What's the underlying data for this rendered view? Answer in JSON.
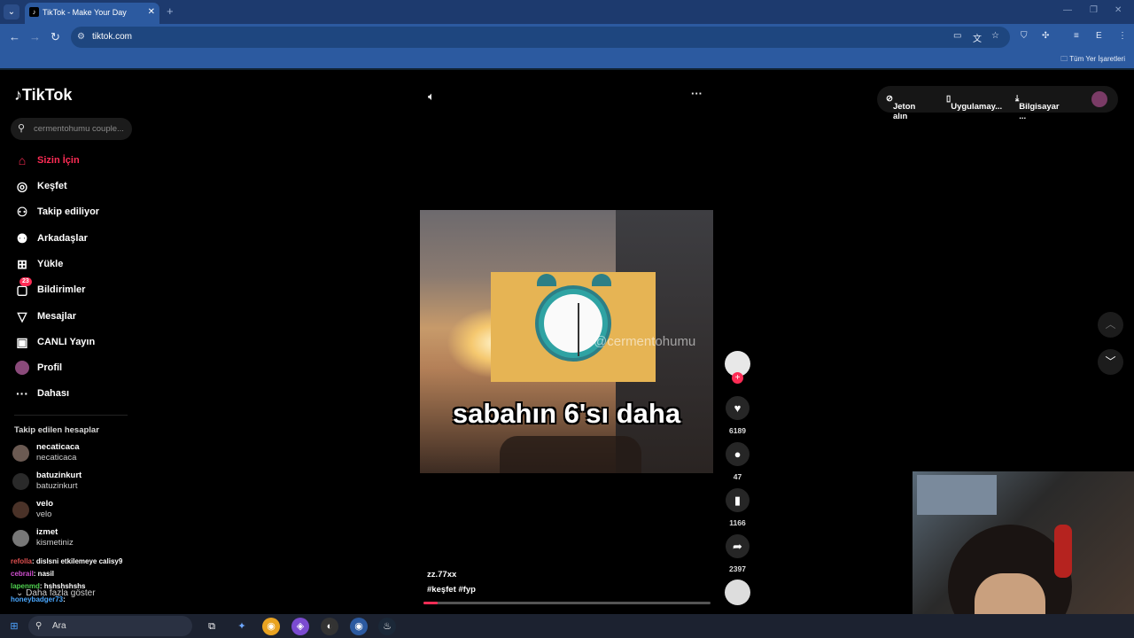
{
  "browser": {
    "tab_title": "TikTok - Make Your Day",
    "url": "tiktok.com",
    "bookmarks_label": "Tüm Yer İşaretleri"
  },
  "sidebar": {
    "logo": "TikTok",
    "search_placeholder": "cermentohumu couple...",
    "items": [
      {
        "label": "Sizin İçin",
        "icon": "home-icon"
      },
      {
        "label": "Keşfet",
        "icon": "compass-icon"
      },
      {
        "label": "Takip ediliyor",
        "icon": "following-icon"
      },
      {
        "label": "Arkadaşlar",
        "icon": "friends-icon"
      },
      {
        "label": "Yükle",
        "icon": "upload-icon"
      },
      {
        "label": "Bildirimler",
        "icon": "inbox-icon",
        "badge": "23"
      },
      {
        "label": "Mesajlar",
        "icon": "send-icon"
      },
      {
        "label": "CANLI Yayın",
        "icon": "live-icon"
      },
      {
        "label": "Profil",
        "icon": "profile-avatar"
      },
      {
        "label": "Dahası",
        "icon": "more-icon"
      }
    ],
    "following_title": "Takip edilen hesaplar",
    "following": [
      {
        "name": "necaticaca",
        "handle": "necaticaca"
      },
      {
        "name": "batuzinkurt",
        "handle": "batuzinkurt"
      },
      {
        "name": "velo",
        "handle": "velo"
      },
      {
        "name": "izmet",
        "handle": "kismetiniz"
      }
    ],
    "see_more": "Daha fazla göster"
  },
  "chat_overlay": [
    {
      "user": "refolla",
      "text": ": dislsni etkilemeye calisy9"
    },
    {
      "user": "cebrail",
      "text": ": nasil"
    },
    {
      "user": "lapenmd",
      "text": ": hshshshshs"
    },
    {
      "user": "honeybadger73",
      "text": ":"
    }
  ],
  "topbar": {
    "coins": "Jeton alın",
    "app": "Uygulamay...",
    "desktop": "Bilgisayar ..."
  },
  "video": {
    "caption": "sabahın 6'sı daha",
    "watermark": "@cermentohumu",
    "author": "zz.77xx",
    "tags": "#keşfet  #fyp",
    "progress": 0.05
  },
  "actions": {
    "likes": "6189",
    "comments": "47",
    "saves": "1166",
    "shares": "2397"
  },
  "taskbar": {
    "search": "Ara"
  }
}
